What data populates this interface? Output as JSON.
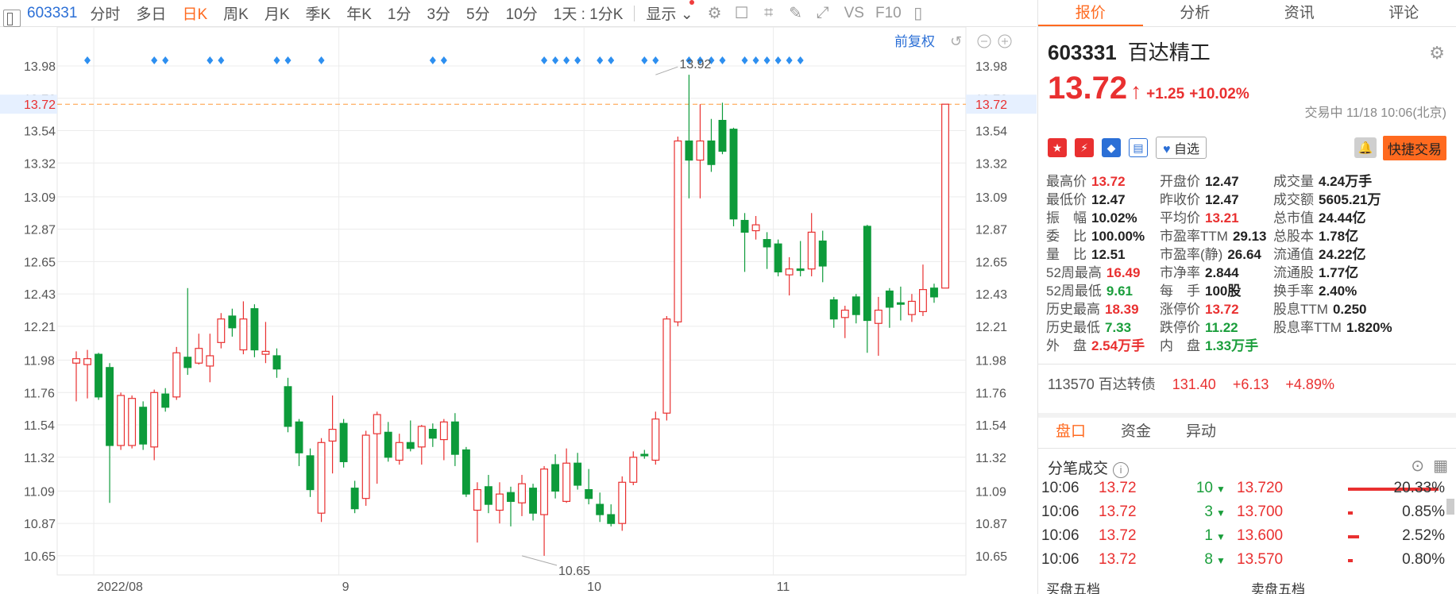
{
  "toolbar": {
    "code": "603331",
    "items": [
      "分时",
      "多日",
      "日K",
      "周K",
      "月K",
      "季K",
      "年K",
      "1分",
      "3分",
      "5分",
      "10分",
      "1天 : 1分K"
    ],
    "active": "日K",
    "display_label": "显示",
    "vs_label": "VS",
    "f10_label": "F10"
  },
  "chart_controls": {
    "adjust_label": "前复权"
  },
  "chart_data": {
    "type": "candlestick",
    "y_ticks": [
      13.98,
      13.76,
      13.54,
      13.32,
      13.09,
      12.87,
      12.65,
      12.43,
      12.21,
      11.98,
      11.76,
      11.54,
      11.32,
      11.09,
      10.87,
      10.65
    ],
    "y_tick_labels": [
      "13.98",
      "13.76",
      "13.54",
      "13.32",
      "13.09",
      "12.87",
      "12.65",
      "12.43",
      "12.21",
      "11.98",
      "11.76",
      "11.54",
      "11.32",
      "11.09",
      "10.87",
      "10.65"
    ],
    "ylim": [
      10.52,
      14.18
    ],
    "x_labels": [
      {
        "label": "2022/08",
        "index": 2
      },
      {
        "label": "9",
        "index": 24
      },
      {
        "label": "10",
        "index": 46
      },
      {
        "label": "11",
        "index": 63
      }
    ],
    "current_price": 13.72,
    "current_price_label": "13.72",
    "high_annotation": {
      "value": 13.92,
      "label": "13.92",
      "index": 52
    },
    "low_annotation": {
      "value": 10.65,
      "label": "10.65",
      "index": 40
    },
    "candles": [
      [
        11.96,
        11.99,
        12.04,
        11.7
      ],
      [
        11.95,
        11.99,
        12.05,
        11.72
      ],
      [
        12.02,
        11.73,
        12.03,
        11.71
      ],
      [
        11.93,
        11.4,
        11.96,
        11.01
      ],
      [
        11.4,
        11.74,
        11.76,
        11.37
      ],
      [
        11.4,
        11.72,
        11.74,
        11.38
      ],
      [
        11.66,
        11.41,
        11.7,
        11.37
      ],
      [
        11.39,
        11.76,
        11.78,
        11.3
      ],
      [
        11.75,
        11.66,
        11.79,
        11.63
      ],
      [
        11.73,
        12.03,
        12.07,
        11.71
      ],
      [
        12.0,
        11.93,
        12.47,
        11.88
      ],
      [
        11.96,
        12.06,
        12.16,
        11.95
      ],
      [
        11.94,
        12.01,
        12.16,
        11.83
      ],
      [
        12.1,
        12.26,
        12.3,
        12.06
      ],
      [
        12.28,
        12.2,
        12.33,
        12.14
      ],
      [
        12.05,
        12.26,
        12.38,
        12.02
      ],
      [
        12.33,
        12.05,
        12.36,
        12.0
      ],
      [
        12.02,
        12.04,
        12.24,
        11.96
      ],
      [
        12.01,
        11.92,
        12.06,
        11.86
      ],
      [
        11.8,
        11.53,
        11.86,
        11.49
      ],
      [
        11.56,
        11.35,
        11.58,
        11.26
      ],
      [
        11.33,
        11.1,
        11.38,
        11.05
      ],
      [
        10.94,
        11.42,
        11.45,
        10.88
      ],
      [
        11.43,
        11.51,
        11.74,
        11.21
      ],
      [
        11.55,
        11.29,
        11.58,
        11.25
      ],
      [
        11.11,
        10.97,
        11.16,
        10.94
      ],
      [
        11.04,
        11.47,
        11.5,
        10.99
      ],
      [
        11.48,
        11.61,
        11.63,
        11.14
      ],
      [
        11.49,
        11.32,
        11.56,
        11.29
      ],
      [
        11.3,
        11.42,
        11.48,
        11.27
      ],
      [
        11.42,
        11.38,
        11.57,
        11.36
      ],
      [
        11.39,
        11.53,
        11.54,
        11.27
      ],
      [
        11.51,
        11.45,
        11.55,
        11.39
      ],
      [
        11.44,
        11.56,
        11.58,
        11.3
      ],
      [
        11.56,
        11.34,
        11.62,
        11.26
      ],
      [
        11.37,
        11.07,
        11.39,
        11.05
      ],
      [
        10.96,
        11.1,
        11.15,
        10.74
      ],
      [
        11.12,
        11.0,
        11.2,
        10.94
      ],
      [
        10.96,
        11.07,
        11.15,
        10.87
      ],
      [
        11.08,
        11.02,
        11.12,
        10.85
      ],
      [
        11.01,
        11.14,
        11.2,
        10.92
      ],
      [
        11.11,
        10.94,
        11.14,
        10.89
      ],
      [
        10.93,
        11.24,
        11.26,
        10.65
      ],
      [
        11.27,
        11.09,
        11.34,
        11.04
      ],
      [
        11.02,
        11.28,
        11.38,
        11.01
      ],
      [
        11.28,
        11.13,
        11.35,
        11.1
      ],
      [
        11.1,
        11.04,
        11.24,
        11.0
      ],
      [
        11.0,
        10.93,
        11.08,
        10.88
      ],
      [
        10.93,
        10.87,
        11.0,
        10.85
      ],
      [
        10.87,
        11.15,
        11.19,
        10.82
      ],
      [
        11.15,
        11.32,
        11.36,
        11.13
      ],
      [
        11.34,
        11.33,
        11.37,
        11.31
      ],
      [
        11.3,
        11.58,
        11.63,
        11.27
      ],
      [
        11.62,
        12.26,
        12.28,
        11.57
      ],
      [
        12.24,
        13.47,
        13.5,
        12.21
      ],
      [
        13.47,
        13.34,
        13.92,
        13.08
      ],
      [
        13.34,
        13.47,
        13.72,
        13.08
      ],
      [
        13.47,
        13.31,
        13.62,
        13.26
      ],
      [
        13.61,
        13.4,
        13.73,
        13.38
      ],
      [
        13.55,
        12.94,
        13.56,
        12.89
      ],
      [
        12.93,
        12.85,
        12.98,
        12.58
      ],
      [
        12.86,
        12.9,
        12.96,
        12.8
      ],
      [
        12.8,
        12.75,
        12.85,
        12.6
      ],
      [
        12.77,
        12.58,
        12.8,
        12.55
      ],
      [
        12.56,
        12.6,
        12.68,
        12.42
      ],
      [
        12.6,
        12.59,
        12.79,
        12.55
      ],
      [
        12.6,
        12.85,
        12.98,
        12.55
      ],
      [
        12.79,
        12.62,
        12.86,
        12.51
      ],
      [
        12.39,
        12.26,
        12.41,
        12.2
      ],
      [
        12.27,
        12.32,
        12.35,
        12.13
      ],
      [
        12.41,
        12.29,
        12.43,
        12.23
      ],
      [
        12.89,
        12.25,
        12.9,
        12.03
      ],
      [
        12.23,
        12.32,
        12.41,
        12.01
      ],
      [
        12.45,
        12.34,
        12.47,
        12.2
      ],
      [
        12.37,
        12.36,
        12.48,
        12.25
      ],
      [
        12.29,
        12.38,
        12.43,
        12.24
      ],
      [
        12.31,
        12.46,
        12.63,
        12.28
      ],
      [
        12.47,
        12.41,
        12.5,
        12.37
      ],
      [
        12.47,
        13.72,
        13.72,
        12.47
      ]
    ],
    "markers": [
      1,
      7,
      8,
      12,
      13,
      18,
      19,
      22,
      32,
      33,
      42,
      43,
      44,
      45,
      47,
      48,
      51,
      52,
      55,
      56,
      57,
      58,
      60,
      61,
      62,
      63,
      64,
      65
    ]
  },
  "stock": {
    "code": "603331",
    "name": "百达精工",
    "price": "13.72",
    "change": "+1.25",
    "change_pct": "+10.02%",
    "trade_time": "交易中 11/18 10:06(北京)",
    "watch_label": "自选",
    "quick_trade_label": "快捷交易"
  },
  "tabs": [
    "报价",
    "分析",
    "资讯",
    "评论"
  ],
  "stats": [
    {
      "label": "最高价",
      "value": "13.72",
      "color": "red"
    },
    {
      "label": "开盘价",
      "value": "12.47",
      "color": "normal"
    },
    {
      "label": "成交量",
      "value": "4.24万手",
      "color": "normal"
    },
    {
      "label": "最低价",
      "value": "12.47",
      "color": "normal"
    },
    {
      "label": "昨收价",
      "value": "12.47",
      "color": "normal"
    },
    {
      "label": "成交额",
      "value": "5605.21万",
      "color": "normal"
    },
    {
      "label": "振　幅",
      "value": "10.02%",
      "color": "normal"
    },
    {
      "label": "平均价",
      "value": "13.21",
      "color": "red"
    },
    {
      "label": "总市值",
      "value": "24.44亿",
      "color": "normal"
    },
    {
      "label": "委　比",
      "value": "100.00%",
      "color": "normal"
    },
    {
      "label": "市盈率TTM",
      "value": "29.13",
      "color": "normal"
    },
    {
      "label": "总股本",
      "value": "1.78亿",
      "color": "normal"
    },
    {
      "label": "量　比",
      "value": "12.51",
      "color": "normal"
    },
    {
      "label": "市盈率(静)",
      "value": "26.64",
      "color": "normal"
    },
    {
      "label": "流通值",
      "value": "24.22亿",
      "color": "normal"
    },
    {
      "label": "52周最高",
      "value": "16.49",
      "color": "red"
    },
    {
      "label": "市净率",
      "value": "2.844",
      "color": "normal"
    },
    {
      "label": "流通股",
      "value": "1.77亿",
      "color": "normal"
    },
    {
      "label": "52周最低",
      "value": "9.61",
      "color": "green"
    },
    {
      "label": "每　手",
      "value": "100股",
      "color": "normal"
    },
    {
      "label": "换手率",
      "value": "2.40%",
      "color": "normal"
    },
    {
      "label": "历史最高",
      "value": "18.39",
      "color": "red"
    },
    {
      "label": "涨停价",
      "value": "13.72",
      "color": "red"
    },
    {
      "label": "股息TTM",
      "value": "0.250",
      "color": "normal"
    },
    {
      "label": "历史最低",
      "value": "7.33",
      "color": "green"
    },
    {
      "label": "跌停价",
      "value": "11.22",
      "color": "green"
    },
    {
      "label": "股息率TTM",
      "value": "1.820%",
      "color": "normal"
    },
    {
      "label": "外　盘",
      "value": "2.54万手",
      "color": "red"
    },
    {
      "label": "内　盘",
      "value": "1.33万手",
      "color": "green"
    }
  ],
  "bond": {
    "code": "113570",
    "name": "百达转债",
    "price": "131.40",
    "change": "+6.13",
    "change_pct": "+4.89%"
  },
  "subtabs": [
    "盘口",
    "资金",
    "异动"
  ],
  "fenbi_title": "分笔成交",
  "ticks": [
    {
      "time": "10:06",
      "price": "13.72",
      "vol": "10"
    },
    {
      "time": "10:06",
      "price": "13.72",
      "vol": "3"
    },
    {
      "time": "10:06",
      "price": "13.72",
      "vol": "1"
    },
    {
      "time": "10:06",
      "price": "13.72",
      "vol": "8"
    }
  ],
  "levels": [
    {
      "price": "13.720",
      "pct": "20.33%",
      "fill": 0.2033
    },
    {
      "price": "13.700",
      "pct": "0.85%",
      "fill": 0.0085
    },
    {
      "price": "13.600",
      "pct": "2.52%",
      "fill": 0.0252
    },
    {
      "price": "13.570",
      "pct": "0.80%",
      "fill": 0.008
    }
  ],
  "bottom": {
    "buy_label": "买盘五档",
    "sell_label": "卖盘五档"
  },
  "colors": {
    "up": "#e93030",
    "down": "#0d9b3a",
    "accent": "#ff6a1f",
    "link": "#2b6fd6",
    "marker": "#2d8ff0"
  }
}
